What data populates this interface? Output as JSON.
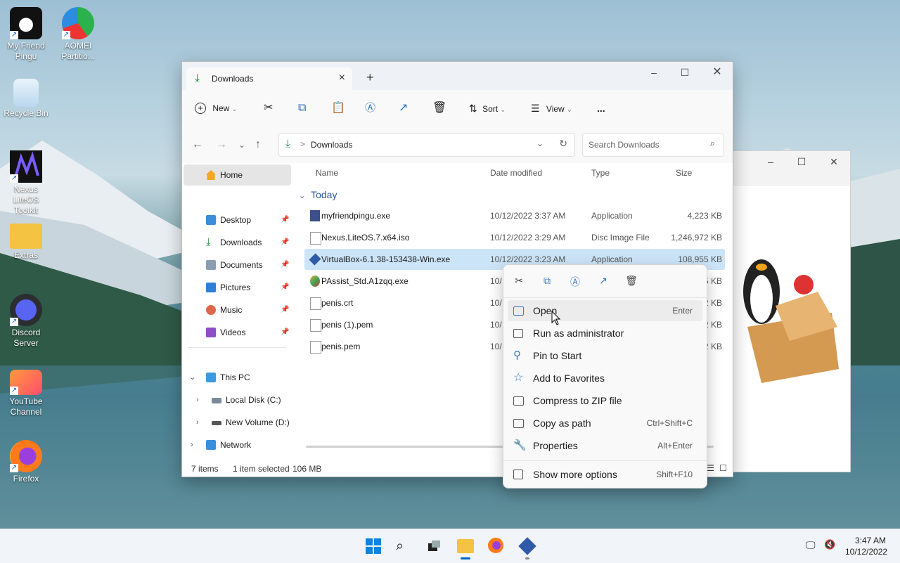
{
  "desktop": {
    "icons": [
      {
        "label": "My Friend Pingu"
      },
      {
        "label": "AOMEI Partitio..."
      },
      {
        "label": "Recycle Bin"
      },
      {
        "label": "Nexus LiteOS Toolkit"
      },
      {
        "label": "Extras"
      },
      {
        "label": "Discord Server"
      },
      {
        "label": "YouTube Channel"
      },
      {
        "label": "Firefox"
      }
    ]
  },
  "explorer": {
    "tab_title": "Downloads",
    "new_tab": "+",
    "toolbar": {
      "new": "New",
      "sort": "Sort",
      "view": "View",
      "more": "..."
    },
    "address": {
      "path": "Downloads",
      "separator": ">"
    },
    "search": {
      "placeholder": "Search Downloads"
    },
    "nav": {
      "home": "Home",
      "quick": [
        "Desktop",
        "Downloads",
        "Documents",
        "Pictures",
        "Music",
        "Videos"
      ],
      "this_pc": "This PC",
      "drives": [
        "Local Disk (C:)",
        "New Volume (D:)"
      ],
      "network": "Network"
    },
    "columns": {
      "name": "Name",
      "date": "Date modified",
      "type": "Type",
      "size": "Size"
    },
    "group": "Today",
    "files": [
      {
        "name": "myfriendpingu.exe",
        "date": "10/12/2022 3:37 AM",
        "type": "Application",
        "size": "4,223 KB"
      },
      {
        "name": "Nexus.LiteOS.7.x64.iso",
        "date": "10/12/2022 3:29 AM",
        "type": "Disc Image File",
        "size": "1,246,972 KB"
      },
      {
        "name": "VirtualBox-6.1.38-153438-Win.exe",
        "date": "10/12/2022 3:23 AM",
        "type": "Application",
        "size": "108,955 KB"
      },
      {
        "name": "PAssist_Std.A1zqq.exe",
        "date": "10/",
        "type": "",
        "size": "5 KB"
      },
      {
        "name": "penis.crt",
        "date": "10/",
        "type": "",
        "size": "2 KB"
      },
      {
        "name": "penis (1).pem",
        "date": "10/",
        "type": "",
        "size": "2 KB"
      },
      {
        "name": "penis.pem",
        "date": "10/",
        "type": "",
        "size": "2 KB"
      }
    ],
    "status": {
      "items": "7 items",
      "selected": "1 item selected",
      "size": "106 MB"
    }
  },
  "context_menu": {
    "items": [
      {
        "label": "Open",
        "shortcut": "Enter"
      },
      {
        "label": "Run as administrator",
        "shortcut": ""
      },
      {
        "label": "Pin to Start",
        "shortcut": ""
      },
      {
        "label": "Add to Favorites",
        "shortcut": ""
      },
      {
        "label": "Compress to ZIP file",
        "shortcut": ""
      },
      {
        "label": "Copy as path",
        "shortcut": "Ctrl+Shift+C"
      },
      {
        "label": "Properties",
        "shortcut": "Alt+Enter"
      }
    ],
    "more": {
      "label": "Show more options",
      "shortcut": "Shift+F10"
    }
  },
  "taskbar": {
    "time": "3:47 AM",
    "date": "10/12/2022"
  },
  "colors": {
    "accent": "#0067c0",
    "selection": "#cce4f7",
    "folder": "#f5c342"
  }
}
